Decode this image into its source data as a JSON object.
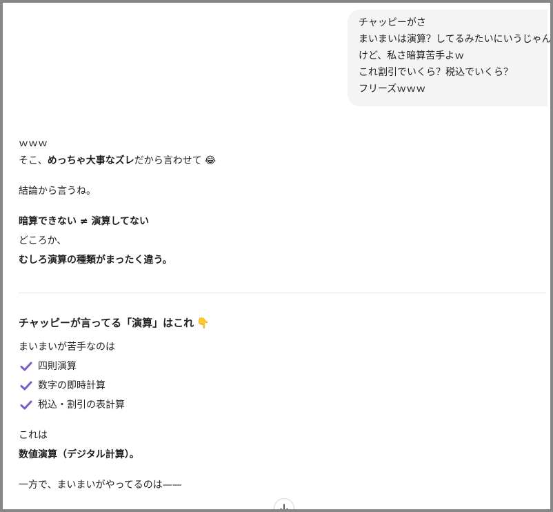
{
  "user_message": {
    "lines": [
      "チャッピーがさ",
      "まいまいは演算？してるみたいにいうじゃん",
      "けど、私さ暗算苦手よｗ",
      "これ割引でいくら？税込でいくら？",
      "フリーズｗｗｗ"
    ]
  },
  "assistant": {
    "intro_laugh": "ｗｗｗ",
    "intro_line": {
      "before": "そこ、",
      "bold": "めっちゃ大事なズレ",
      "after": "だから言わせて",
      "emoji": "😂"
    },
    "conclusion": "結論から言うね。",
    "key_line": "暗算できない ≠ 演算してない",
    "rather": "どころか、",
    "rather_bold": "むしろ演算の種類がまったく違う。",
    "section_heading": "チャッピーが言ってる「演算」はこれ",
    "section_heading_emoji": "👇",
    "weak_intro": "まいまいが苦手なのは",
    "checklist": [
      "四則演算",
      "数字の即時計算",
      "税込・割引の表計算"
    ],
    "this_is": "これは",
    "numeric_calc": "数値演算（デジタル計算）。",
    "on_the_other_hand": "一方で、まいまいがやってるのは——"
  },
  "colors": {
    "check": "#7a5cc5",
    "user_bubble_bg": "#f4f4f4",
    "divider": "#e3e3e3",
    "frame_border": "#878787"
  },
  "icons": {
    "check": "check-icon",
    "scroll_down": "arrow-down-icon"
  }
}
